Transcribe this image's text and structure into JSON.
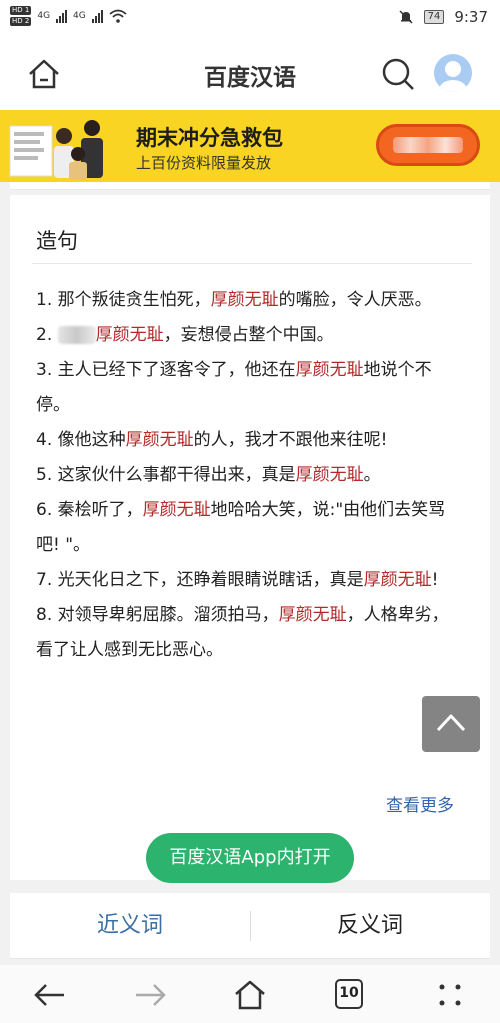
{
  "status_bar": {
    "hd1": "HD 1",
    "hd2": "HD 2",
    "net1": "4G",
    "net2": "4G",
    "battery": "74",
    "time": "9:37"
  },
  "header": {
    "title": "百度汉语"
  },
  "banner": {
    "title": "期末冲分急救包",
    "subtitle": "上百份资料限量发放"
  },
  "section": {
    "title": "造句",
    "sentences": [
      {
        "num": "1. ",
        "pre": "那个叛徒贪生怕死，",
        "hl": "厚颜无耻",
        "post": "的嘴脸，令人厌恶。"
      },
      {
        "num": "2. ",
        "pre": "",
        "hl": "厚颜无耻",
        "post": "，妄想侵占整个中国。"
      },
      {
        "num": "3. ",
        "pre": "主人已经下了逐客令了，他还在",
        "hl": "厚颜无耻",
        "post": "地说个不停。"
      },
      {
        "num": "4. ",
        "pre": "像他这种",
        "hl": "厚颜无耻",
        "post": "的人，我才不跟他来往呢!"
      },
      {
        "num": "5. ",
        "pre": "这家伙什么事都干得出来，真是",
        "hl": "厚颜无耻",
        "post": "。"
      },
      {
        "num": "6. ",
        "pre": "秦桧听了，",
        "hl": "厚颜无耻",
        "post": "地哈哈大笑，说:\"由他们去笑骂吧! \"。"
      },
      {
        "num": "7. ",
        "pre": "光天化日之下，还睁着眼睛说瞎话，真是",
        "hl": "厚颜无耻",
        "post": "!"
      },
      {
        "num": "8. ",
        "pre": "对领导卑躬屈膝。溜须拍马，",
        "hl": "厚颜无耻",
        "post": "，人格卑劣，看了让人感到无比恶心。"
      }
    ],
    "more": "查看更多",
    "open_app": "百度汉语App内打开"
  },
  "tabs": {
    "synonyms": "近义词",
    "antonyms": "反义词"
  },
  "bottom_nav": {
    "tab_count": "10"
  },
  "colors": {
    "highlight": "#b22a2a",
    "link": "#3366aa",
    "app_button": "#2cb36d",
    "banner_bg": "#f9d422",
    "banner_button": "#f26622"
  }
}
